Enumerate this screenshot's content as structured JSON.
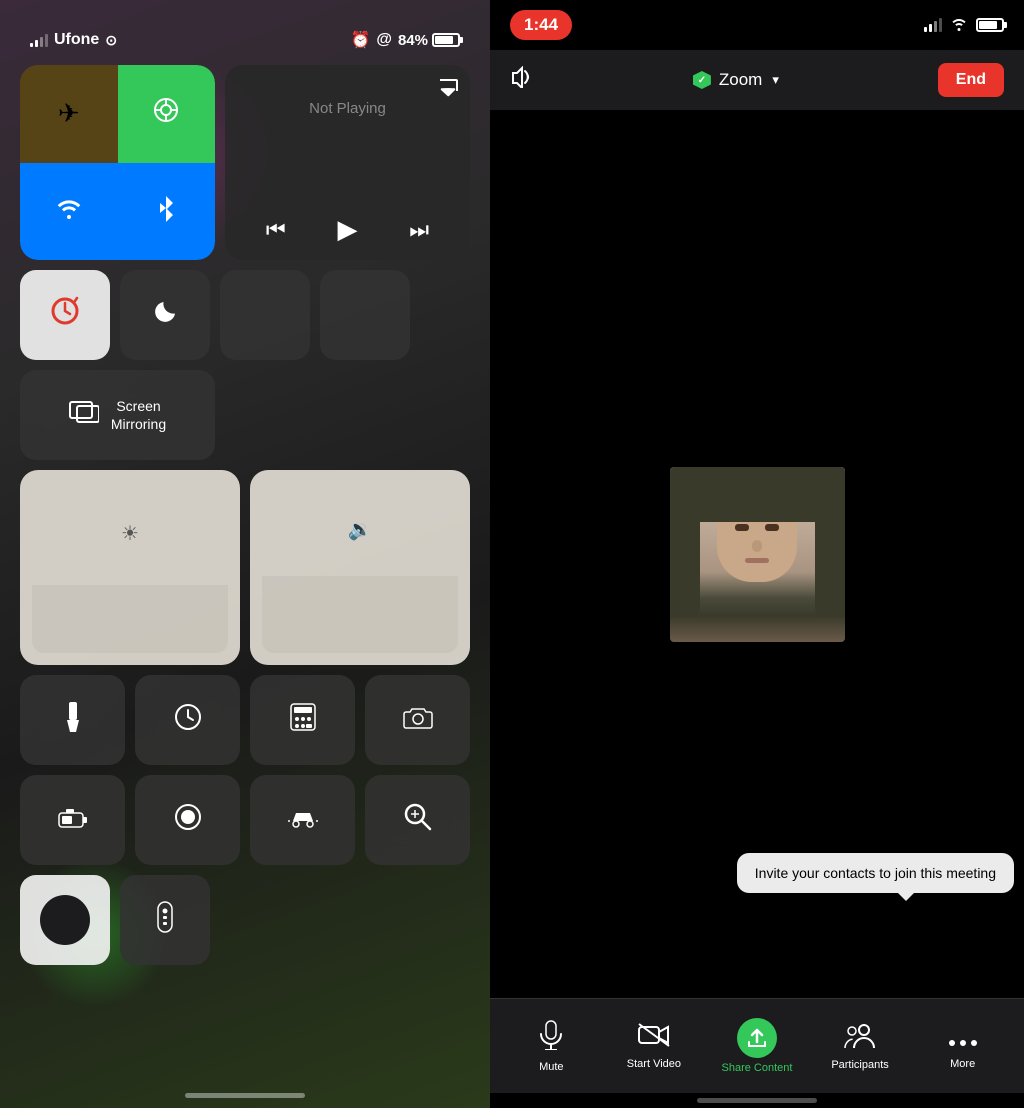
{
  "left": {
    "status": {
      "carrier": "Ufone",
      "wifi": true,
      "alarm_icon": "⏰",
      "location_icon": "@",
      "battery_percent": "84%"
    },
    "connectivity": {
      "airplane": "✈",
      "cellular": "📶",
      "wifi": "wifi",
      "bluetooth": "bluetooth"
    },
    "media": {
      "not_playing": "Not Playing",
      "airplay_icon": "aircast"
    },
    "small_buttons": {
      "lock_rotation": "rotation-lock",
      "do_not_disturb": "moon"
    },
    "screen_mirroring": {
      "label_line1": "Screen",
      "label_line2": "Mirroring"
    },
    "icons_row1": [
      "flashlight",
      "screen-time",
      "calculator",
      "camera"
    ],
    "icons_row2": [
      "battery-case",
      "record",
      "car",
      "zoom-search"
    ],
    "special": [
      "dark-mode",
      "remote"
    ]
  },
  "right": {
    "status": {
      "time": "1:44"
    },
    "header": {
      "zoom_label": "Zoom",
      "end_label": "End"
    },
    "toolbar": {
      "mute_label": "Mute",
      "start_video_label": "Start Video",
      "share_content_label": "Share Content",
      "participants_label": "Participants",
      "more_label": "More"
    },
    "invite_tooltip": "Invite your contacts to join this meeting"
  }
}
